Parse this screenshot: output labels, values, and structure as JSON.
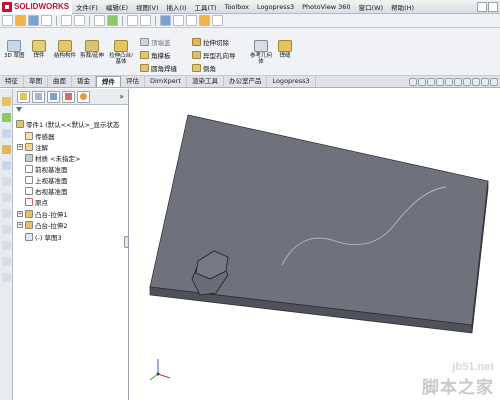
{
  "app": {
    "logo_text": "SOLIDWORKS"
  },
  "menu": [
    "文件(F)",
    "编辑(E)",
    "视图(V)",
    "插入(I)",
    "工具(T)",
    "Toolbox",
    "Logopress3",
    "PhotoView 360",
    "窗口(W)",
    "帮助(H)"
  ],
  "ribbon": {
    "large_buttons": [
      {
        "label": "3D 草图"
      },
      {
        "label": "焊件"
      },
      {
        "label": "结构构件"
      },
      {
        "label": "剪裁/延伸"
      },
      {
        "label": "拉伸凸台/基体"
      },
      {
        "label": "参考几何体"
      },
      {
        "label": "焊缝"
      }
    ],
    "small_buttons": [
      {
        "label": "顶端盖"
      },
      {
        "label": "角撑板"
      },
      {
        "label": "圆角焊缝"
      },
      {
        "label": "拉伸切除"
      },
      {
        "label": "异型孔向导"
      },
      {
        "label": "倒角"
      }
    ]
  },
  "tabs": [
    "特征",
    "草图",
    "曲面",
    "钣金",
    "焊件",
    "评估",
    "DimXpert",
    "渲染工具",
    "办公室产品",
    "Logopress3"
  ],
  "active_tab": "焊件",
  "feature_tree": {
    "collapse_glyph": "»",
    "items": [
      {
        "label": "零件1 (默认<<默认>_显示状态"
      },
      {
        "label": "传感器"
      },
      {
        "label": "注解"
      },
      {
        "label": "材质 <未指定>"
      },
      {
        "label": "前视基准面"
      },
      {
        "label": "上视基准面"
      },
      {
        "label": "右视基准面"
      },
      {
        "label": "原点"
      },
      {
        "label": "凸台-拉伸1"
      },
      {
        "label": "凸台-拉伸2"
      },
      {
        "label": "(-) 草图3"
      }
    ]
  },
  "watermark": {
    "site": "jb51.net",
    "name": "脚本之家"
  },
  "colors": {
    "part_top": "#6f727c",
    "part_side": "#4f525b",
    "sketch_line": "#b9bcc4"
  }
}
